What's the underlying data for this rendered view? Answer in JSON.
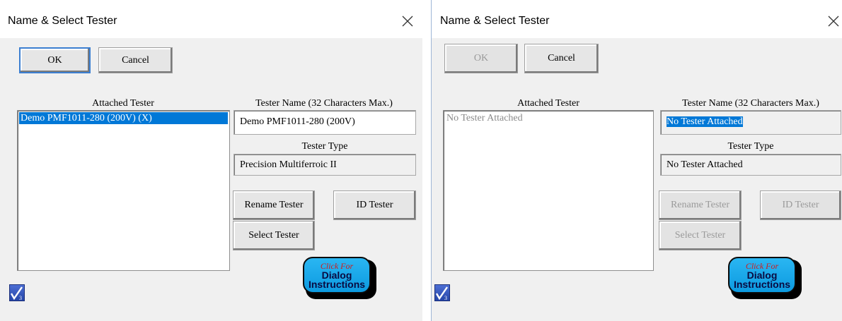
{
  "left": {
    "title": "Name & Select Tester",
    "ok_label": "OK",
    "cancel_label": "Cancel",
    "attached_heading": "Attached Tester",
    "attached_items": [
      "Demo PMF1011-280 (200V) (X)"
    ],
    "name_heading": "Tester Name (32 Characters Max.)",
    "name_value": "Demo PMF1011-280 (200V)",
    "type_heading": "Tester Type",
    "type_value": "Precision Multiferroic II",
    "rename_label": "Rename Tester",
    "id_label": "ID Tester",
    "select_label": "Select Tester",
    "help_line1": "Click For",
    "help_line2": "Dialog",
    "help_line3": "Instructions"
  },
  "right": {
    "title": "Name & Select Tester",
    "ok_label": "OK",
    "cancel_label": "Cancel",
    "attached_heading": "Attached Tester",
    "attached_items": [
      "No Tester Attached"
    ],
    "name_heading": "Tester Name (32 Characters Max.)",
    "name_value": "No Tester Attached",
    "type_heading": "Tester Type",
    "type_value": "No Tester Attached",
    "rename_label": "Rename Tester",
    "id_label": "ID Tester",
    "select_label": "Select Tester",
    "help_line1": "Click For",
    "help_line2": "Dialog",
    "help_line3": "Instructions"
  },
  "icons": {
    "close": "close-icon",
    "app": "app-checkmark-icon"
  },
  "colors": {
    "selection": "#0078d7",
    "help_button": "#1aa8ea",
    "help_text_red": "#d21c1c"
  }
}
